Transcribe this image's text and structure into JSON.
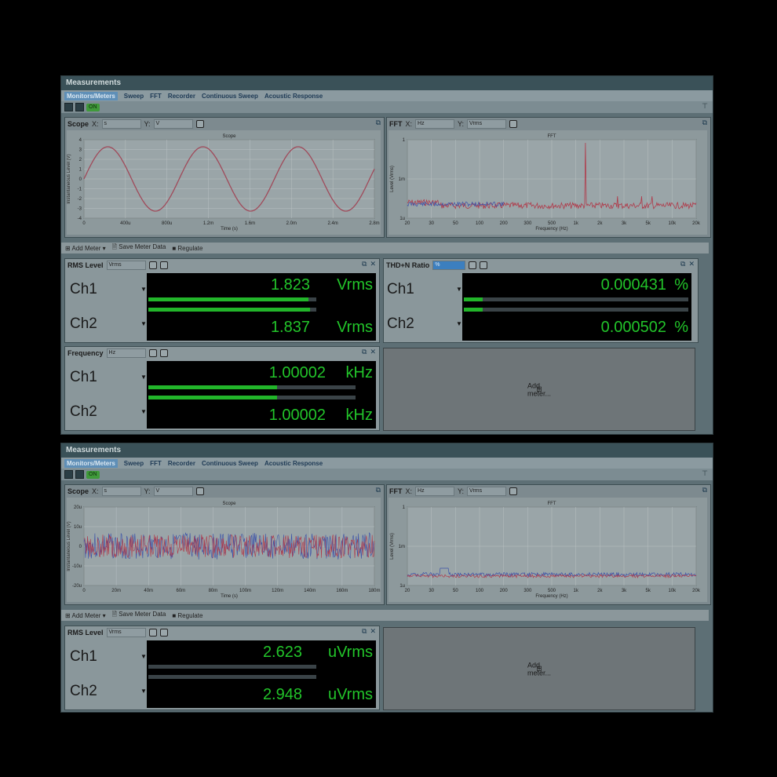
{
  "windows": [
    {
      "title": "Measurements",
      "tabs": [
        "Monitors/Meters",
        "Sweep",
        "FFT",
        "Recorder",
        "Continuous Sweep",
        "Acoustic Response"
      ],
      "on_label": "ON",
      "scope": {
        "title": "Scope",
        "x_label": "X:",
        "x_unit": "s",
        "y_label": "Y:",
        "y_unit": "V",
        "plot_title": "Scope",
        "ylabel": "Instantaneous Level (V)",
        "xlabel": "Time (s)",
        "yticks": [
          "4",
          "3",
          "2",
          "1",
          "0",
          "-1",
          "-2",
          "-3",
          "-4"
        ],
        "xticks": [
          "0",
          "400u",
          "800u",
          "1.2m",
          "1.6m",
          "2.0m",
          "2.4m",
          "2.8m"
        ]
      },
      "fft": {
        "title": "FFT",
        "x_label": "X:",
        "x_unit": "Hz",
        "y_label": "Y:",
        "y_unit": "Vrms",
        "plot_title": "FFT",
        "ylabel": "Level (Vrms)",
        "xlabel": "Frequency (Hz)",
        "yticks": [
          "1",
          "1m",
          "1u"
        ],
        "xticks": [
          "20",
          "30",
          "50",
          "100",
          "200",
          "300",
          "500",
          "1k",
          "2k",
          "3k",
          "5k",
          "10k",
          "20k"
        ]
      },
      "toolbar": {
        "add_meter": "Add Meter",
        "save": "Save Meter Data",
        "regulate": "Regulate"
      },
      "meters": {
        "rms": {
          "title": "RMS Level",
          "unit_sel": "Vrms",
          "ch1": {
            "label": "Ch1",
            "value": "1.823",
            "unit": "Vrms"
          },
          "ch2": {
            "label": "Ch2",
            "value": "1.837",
            "unit": "Vrms"
          }
        },
        "thd": {
          "title": "THD+N Ratio",
          "unit_sel": "%",
          "ch1": {
            "label": "Ch1",
            "value": "0.000431",
            "unit": "%"
          },
          "ch2": {
            "label": "Ch2",
            "value": "0.000502",
            "unit": "%"
          }
        },
        "freq": {
          "title": "Frequency",
          "unit_sel": "Hz",
          "ch1": {
            "label": "Ch1",
            "value": "1.00002",
            "unit": "kHz"
          },
          "ch2": {
            "label": "Ch2",
            "value": "1.00002",
            "unit": "kHz"
          }
        },
        "add_meter": "Add meter..."
      }
    },
    {
      "title": "Measurements",
      "tabs": [
        "Monitors/Meters",
        "Sweep",
        "FFT",
        "Recorder",
        "Continuous Sweep",
        "Acoustic Response"
      ],
      "on_label": "ON",
      "scope": {
        "title": "Scope",
        "x_label": "X:",
        "x_unit": "s",
        "y_label": "Y:",
        "y_unit": "V",
        "plot_title": "Scope",
        "ylabel": "Instantaneous Level (V)",
        "xlabel": "Time (s)",
        "yticks": [
          "20u",
          "10u",
          "0",
          "-10u",
          "-20u"
        ],
        "xticks": [
          "0",
          "20m",
          "40m",
          "60m",
          "80m",
          "100m",
          "120m",
          "140m",
          "160m",
          "180m"
        ]
      },
      "fft": {
        "title": "FFT",
        "x_label": "X:",
        "x_unit": "Hz",
        "y_label": "Y:",
        "y_unit": "Vrms",
        "plot_title": "FFT",
        "ylabel": "Level (Vrms)",
        "xlabel": "Frequency (Hz)",
        "yticks": [
          "1",
          "1m",
          "1u"
        ],
        "xticks": [
          "20",
          "30",
          "50",
          "100",
          "200",
          "300",
          "500",
          "1k",
          "2k",
          "3k",
          "5k",
          "10k",
          "20k"
        ]
      },
      "toolbar": {
        "add_meter": "Add Meter",
        "save": "Save Meter Data",
        "regulate": "Regulate"
      },
      "meters": {
        "rms": {
          "title": "RMS Level",
          "unit_sel": "Vrms",
          "ch1": {
            "label": "Ch1",
            "value": "2.623",
            "unit": "uVrms"
          },
          "ch2": {
            "label": "Ch2",
            "value": "2.948",
            "unit": "uVrms"
          }
        },
        "add_meter": "Add meter..."
      }
    }
  ]
}
